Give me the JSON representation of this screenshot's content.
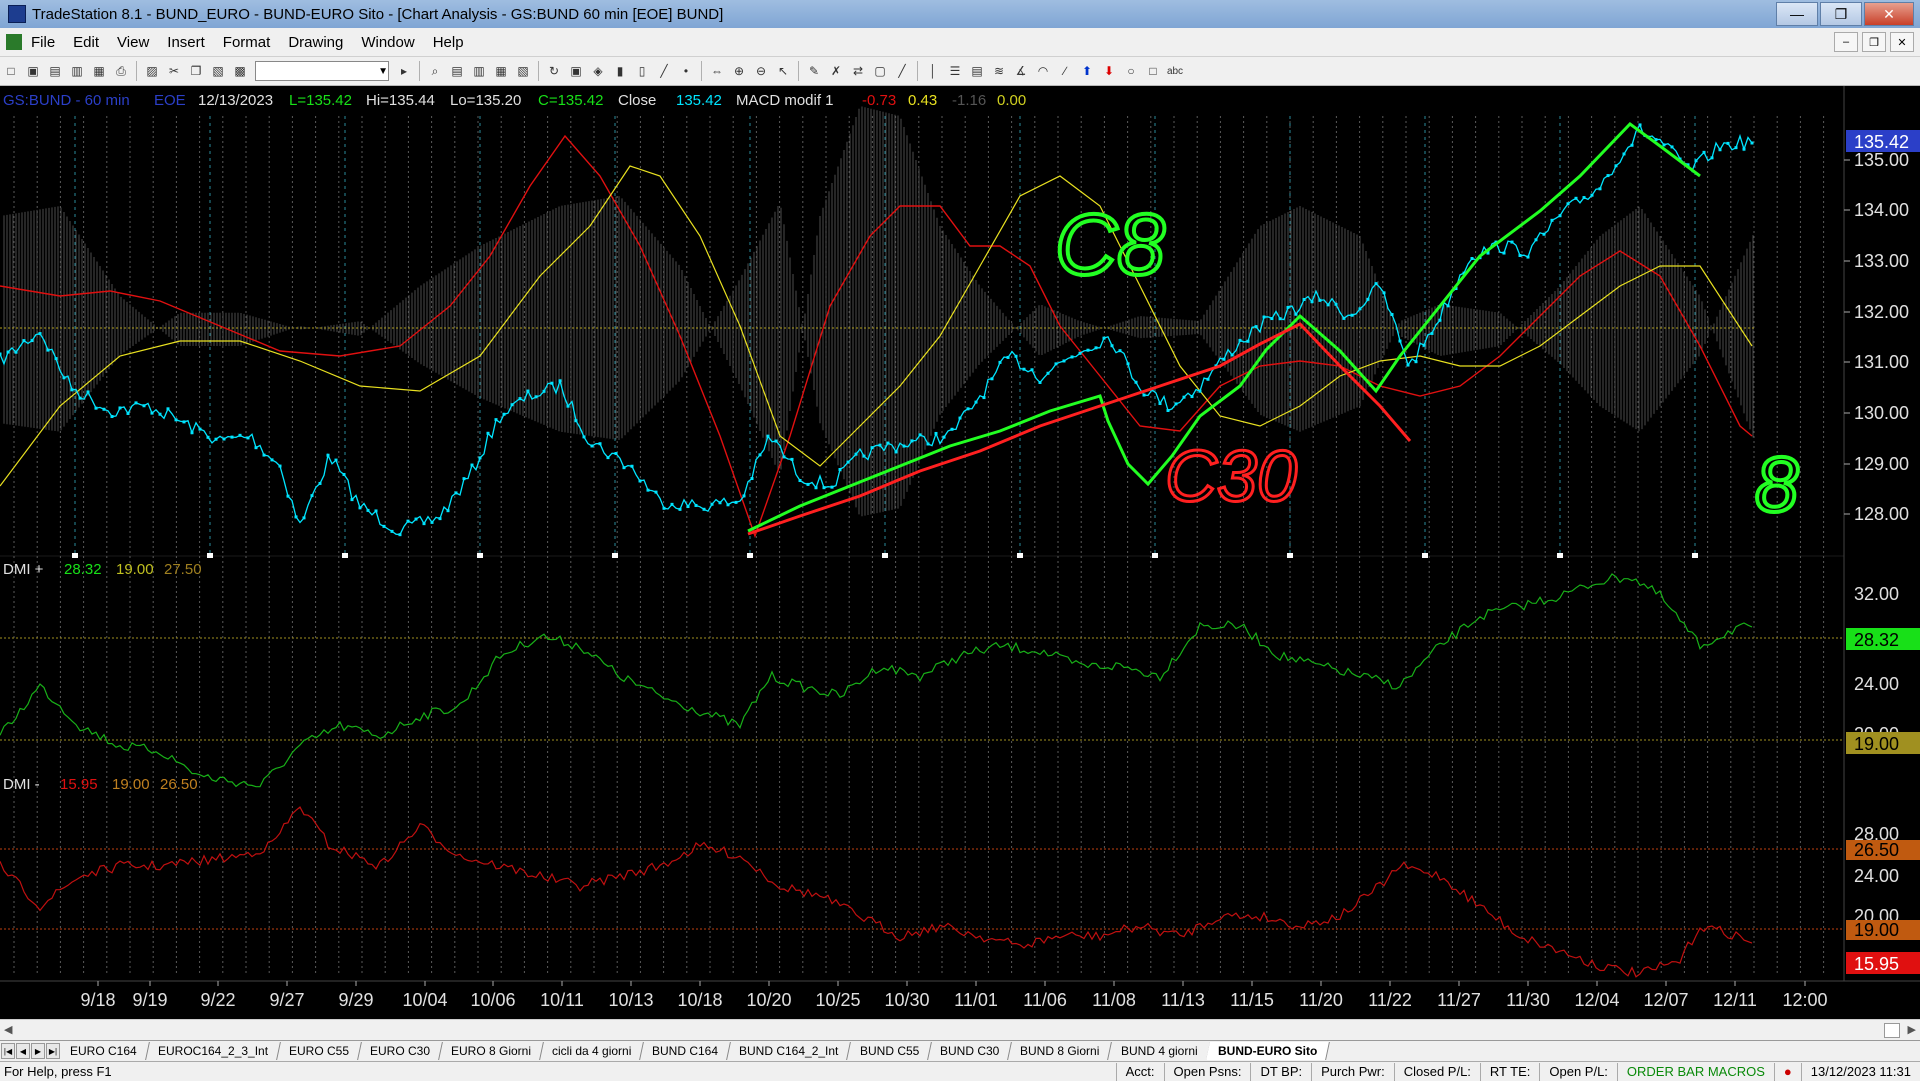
{
  "window": {
    "title": "TradeStation 8.1 - BUND_EURO - BUND-EURO Sito - [Chart Analysis - GS:BUND  60 min  [EOE] BUND]",
    "minimize_glyph": "—",
    "maximize_glyph": "❐",
    "close_glyph": "✕"
  },
  "menu": {
    "items": [
      "File",
      "Edit",
      "View",
      "Insert",
      "Format",
      "Drawing",
      "Window",
      "Help"
    ],
    "mdi_minimize": "–",
    "mdi_restore": "❐",
    "mdi_close": "✕"
  },
  "toolbar": {
    "icons": [
      "new-icon",
      "open-icon",
      "save-icon",
      "workspace-icon",
      "folder-icon",
      "print-icon",
      "print-preview-icon",
      "cut-icon",
      "copy-icon",
      "paste-icon",
      "format-icon",
      "combo",
      "arrow-right-icon",
      "zoom-icon",
      "bars-icon",
      "insert-indicator-icon",
      "analysis-icon",
      "strategy-icon",
      "refresh-icon",
      "format-window-icon",
      "chart-style-icon",
      "bar-chart-icon",
      "candle-icon",
      "line-icon",
      "dot-icon",
      "cursor-icon",
      "zoom-in-icon",
      "zoom-out-icon",
      "pointer-icon",
      "drawing-icon",
      "tools-icon",
      "link-icon",
      "lock-icon",
      "trendline-icon",
      "vertical-line-icon",
      "horizontal-line-icon",
      "channel-icon",
      "fib-icon",
      "gann-icon",
      "arc-icon",
      "text-icon",
      "up-arrow-icon",
      "down-arrow-icon",
      "circle-icon",
      "rect-icon",
      "abc-icon"
    ],
    "combo_value": ""
  },
  "chart": {
    "header": {
      "symbol": "GS:BUND - 60 min",
      "feed": "EOE",
      "date": "12/13/2023",
      "low_last": "L=135.42",
      "high": "Hi=135.44",
      "low": "Lo=135.20",
      "close": "C=135.42",
      "close_label": "Close",
      "close_value": "135.42",
      "indicator": "MACD modif 1",
      "macd_v1": "-0.73",
      "macd_v2": "0.43",
      "macd_v3": "-1.16",
      "macd_v4": "0.00"
    },
    "price_axis": [
      "135.00",
      "134.00",
      "133.00",
      "132.00",
      "131.00",
      "130.00",
      "129.00",
      "128.00"
    ],
    "price_last": "135.42",
    "dmi_plus": {
      "label": "DMI +",
      "v1": "28.32",
      "v2": "19.00",
      "v3": "27.50",
      "axis": [
        "32.00",
        "24.00",
        "20.00"
      ],
      "last": "28.32",
      "level": "19.00"
    },
    "dmi_minus": {
      "label": "DMI -",
      "v1": "15.95",
      "v2": "19.00",
      "v3": "26.50",
      "axis": [
        "28.00",
        "24.00",
        "20.00"
      ],
      "last": "15.95",
      "level1": "26.50",
      "level2": "19.00"
    },
    "dates": [
      "9/18",
      "9/19",
      "9/22",
      "9/27",
      "9/29",
      "10/04",
      "10/06",
      "10/11",
      "10/13",
      "10/18",
      "10/20",
      "10/25",
      "10/30",
      "11/01",
      "11/06",
      "11/08",
      "11/13",
      "11/15",
      "11/20",
      "11/22",
      "11/27",
      "11/30",
      "12/04",
      "12/07",
      "12/11",
      "12:00"
    ],
    "annotations": [
      "C8",
      "C30",
      "8"
    ],
    "colors": {
      "price": "#00e5ff",
      "macd_fast": "#e01010",
      "macd_slow": "#e8e020",
      "histogram": "#8a8a8a",
      "dmi_plus": "#18b018",
      "dmi_minus": "#c01010",
      "annotation_green": "#22ff22",
      "annotation_red": "#ff2020",
      "axis_last": "#2b3fc8"
    }
  },
  "sheet_tabs": [
    "EURO C164",
    "EUROC164_2_3_Int",
    "EURO C55",
    "EURO C30",
    "EURO 8 Giorni",
    "cicli da 4 giorni",
    "BUND C164",
    "BUND C164_2_Int",
    "BUND C55",
    "BUND  C30",
    "BUND 8 Giorni",
    "BUND 4 giorni",
    "BUND-EURO Sito"
  ],
  "active_tab": "BUND-EURO Sito",
  "status": {
    "help": "For Help, press F1",
    "fields": [
      "Acct:",
      "Open Psns:",
      "DT BP:",
      "Purch Pwr:",
      "Closed P/L:",
      "RT TE:",
      "Open P/L:"
    ],
    "order_bar": "ORDER BAR",
    "macros": "MACROS",
    "datetime": "13/12/2023 11:31"
  }
}
